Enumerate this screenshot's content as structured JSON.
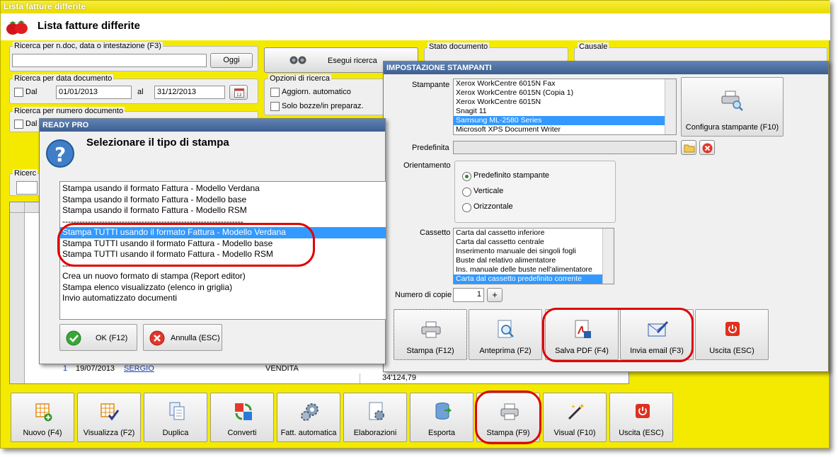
{
  "window": {
    "title": "Lista fatture differite",
    "app_title": "Lista fatture differite"
  },
  "search": {
    "group1_label": "Ricerca per n.doc, data o intestazione (F3)",
    "oggi_label": "Oggi",
    "search_button": "Esegui ricerca",
    "group2_label": "Ricerca per data documento",
    "dal_label": "Dal",
    "date_from": "01/01/2013",
    "al_label": "al",
    "date_to": "31/12/2013",
    "group3_label": "Ricerca per numero documento",
    "dal3_label": "Dal",
    "group4_label": "Ricerc",
    "options_label": "Opzioni di ricerca",
    "opt_auto": "Aggiorn. automatico",
    "opt_bozze": "Solo bozze/in preparaz.",
    "stato_label": "Stato documento",
    "causale_label": "Causale"
  },
  "grid": {
    "row_num": "1",
    "row_date": "19/07/2013",
    "row_name": "SERGIO",
    "row_type": "VENDITA",
    "total": "34'124,79"
  },
  "dialog_print": {
    "title": "READY PRO",
    "heading": "Selezionare il tipo di stampa",
    "items": [
      "Stampa usando il formato Fattura - Modello Verdana",
      "Stampa usando il formato Fattura - Modello base",
      "Stampa usando il formato Fattura - Modello RSM",
      "----------------------------------------------------------------",
      "Stampa TUTTI usando il formato Fattura - Modello Verdana",
      "Stampa TUTTI usando il formato Fattura - Modello base",
      "Stampa TUTTI usando il formato Fattura - Modello RSM",
      "----------------------------------------------------------------",
      "Crea un nuovo formato di stampa (Report editor)",
      "Stampa elenco visualizzato (elenco in griglia)",
      "Invio automatizzato documenti"
    ],
    "selected_index": 4,
    "ok_label": "OK (F12)",
    "cancel_label": "Annulla (ESC)"
  },
  "dialog_printers": {
    "title": "IMPOSTAZIONE STAMPANTI",
    "stampante_label": "Stampante",
    "printers": [
      "Xerox WorkCentre 6015N Fax",
      "Xerox WorkCentre 6015N (Copia 1)",
      "Xerox WorkCentre 6015N",
      "Snagit 11",
      "Samsung ML-2580 Series",
      "Microsoft XPS Document Writer"
    ],
    "selected_printer": 4,
    "config_label": "Configura stampante (F10)",
    "predefinita_label": "Predefinita",
    "orient_label": "Orientamento",
    "orient_opts": [
      "Predefinito stampante",
      "Verticale",
      "Orizzontale"
    ],
    "orient_selected": 0,
    "cassetto_label": "Cassetto",
    "trays": [
      "Carta dal cassetto inferiore",
      "Carta dal cassetto centrale",
      "Inserimento manuale dei singoli fogli",
      "Buste dal relativo alimentatore",
      "Ins. manuale delle buste nell'alimentatore",
      "Carta dal cassetto predefinito corrente"
    ],
    "selected_tray": 5,
    "copies_label": "Numero di copie",
    "copies": "1",
    "plus": "+",
    "buttons": {
      "stampa": "Stampa (F12)",
      "anteprima": "Anteprima (F2)",
      "pdf": "Salva PDF (F4)",
      "email": "Invia email (F3)",
      "uscita": "Uscita (ESC)"
    }
  },
  "toolbar": {
    "nuovo": "Nuovo (F4)",
    "visualizza": "Visualizza (F2)",
    "duplica": "Duplica",
    "converti": "Converti",
    "fatt": "Fatt. automatica",
    "elab": "Elaborazioni",
    "esporta": "Esporta",
    "stampa": "Stampa (F9)",
    "visual": "Visual (F10)",
    "uscita": "Uscita (ESC)"
  },
  "colors": {
    "background": "#f4ea00",
    "dialog_title": "#3d5f8f",
    "selection": "#3399ff",
    "highlight_ring": "#e00000"
  }
}
